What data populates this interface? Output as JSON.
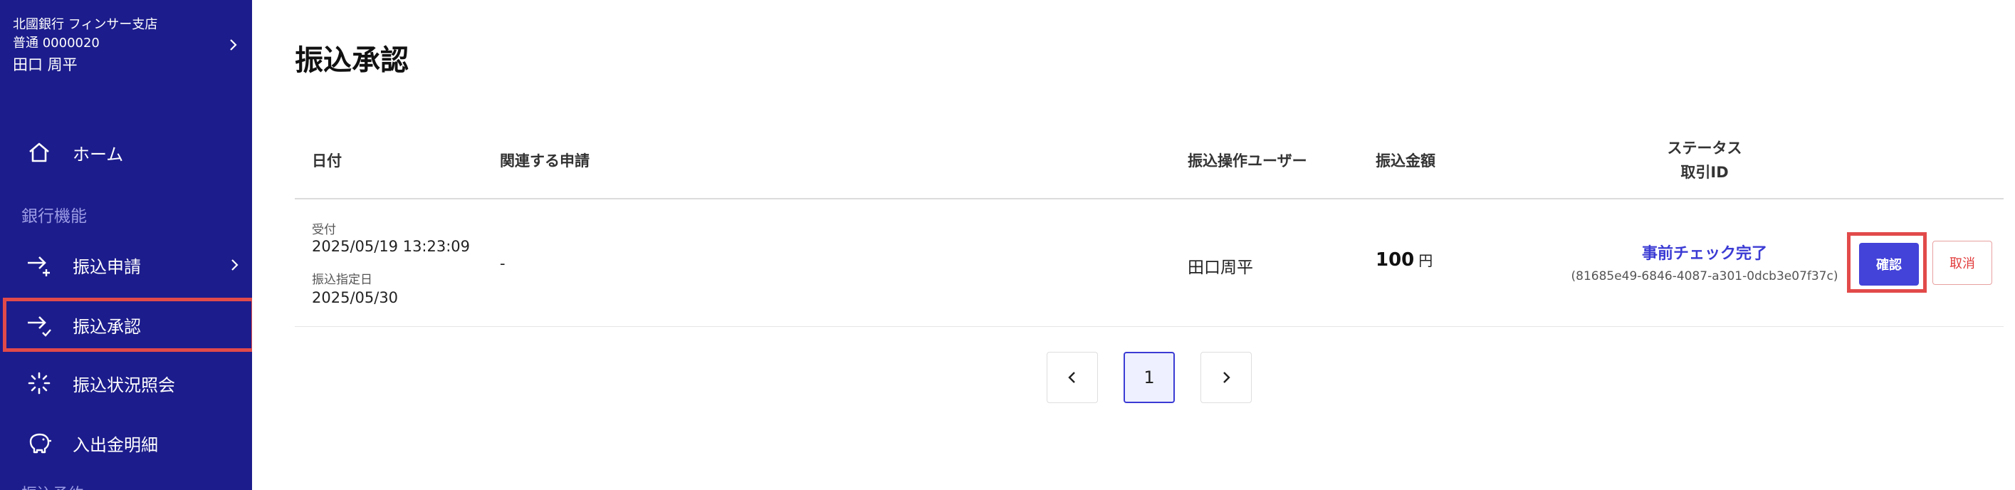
{
  "account": {
    "bank_branch": "北國銀行 フィンサー支店",
    "account_number": "普通 0000020",
    "holder": "田口 周平"
  },
  "sidebar": {
    "section_label": "銀行機能",
    "cut_label": "振込予約",
    "items": [
      {
        "label": "ホーム",
        "icon": "home-icon"
      },
      {
        "label": "振込申請",
        "icon": "transfer-request-icon"
      },
      {
        "label": "振込承認",
        "icon": "transfer-approve-icon"
      },
      {
        "label": "振込状況照会",
        "icon": "loading-icon"
      },
      {
        "label": "入出金明細",
        "icon": "piggy-bank-icon"
      }
    ]
  },
  "page": {
    "title": "振込承認"
  },
  "table": {
    "headers": {
      "date": "日付",
      "related": "関連する申請",
      "user": "振込操作ユーザー",
      "amount": "振込金額",
      "status": "ステータス",
      "txid": "取引ID"
    },
    "rows": [
      {
        "received_label": "受付",
        "received": "2025/05/19 13:23:09",
        "scheduled_label": "振込指定日",
        "scheduled": "2025/05/30",
        "related": "-",
        "user": "田口周平",
        "amount": "100",
        "currency": "円",
        "status": "事前チェック完了",
        "transaction_id": "(81685e49-6846-4087-a301-0dcb3e07f37c)",
        "confirm_label": "確認",
        "cancel_label": "取消"
      }
    ]
  },
  "pagination": {
    "current": "1",
    "prev_icon": "chevron-left-icon",
    "next_icon": "chevron-right-icon"
  },
  "colors": {
    "sidebar_bg": "#1c1c8c",
    "accent": "#4343d9",
    "highlight": "#e24a4a",
    "cancel": "#e23b3b"
  }
}
